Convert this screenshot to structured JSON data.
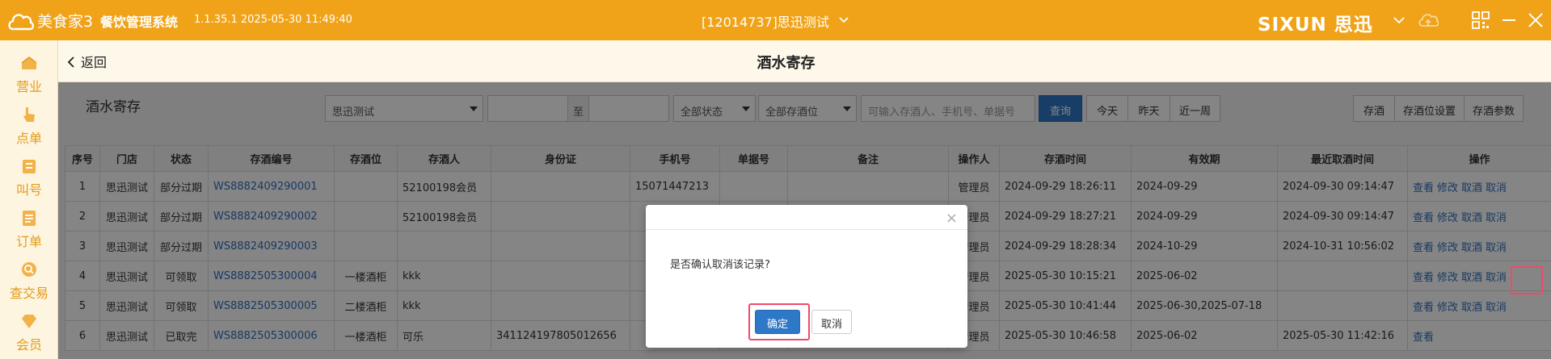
{
  "titlebar": {
    "brand": "美食家3",
    "system_name": "餐饮管理系统",
    "version": "1.1.35.1 2025-05-30 11:49:40",
    "store": "[12014737]思迅测试",
    "company_logo": "SIXUN 思迅",
    "accent_color": "#f0a318"
  },
  "sidebar": {
    "items": [
      {
        "label": "营业",
        "icon": "business-icon"
      },
      {
        "label": "点单",
        "icon": "order-hand-icon"
      },
      {
        "label": "叫号",
        "icon": "call-number-icon"
      },
      {
        "label": "订单",
        "icon": "orders-list-icon"
      },
      {
        "label": "查交易",
        "icon": "search-transaction-icon"
      },
      {
        "label": "会员",
        "icon": "member-diamond-icon"
      }
    ]
  },
  "header": {
    "back_label": "返回",
    "page_title": "酒水寄存"
  },
  "toolbar": {
    "section_title": "酒水寄存",
    "store_select": "思迅测试",
    "date_sep": "至",
    "status_select": "全部状态",
    "location_select": "全部存酒位",
    "search_placeholder": "可输入存酒人、手机号、单据号",
    "query_label": "查询",
    "today_label": "今天",
    "yesterday_label": "昨天",
    "last_week_label": "近一周",
    "deposit_label": "存酒",
    "location_settings_label": "存酒位设置",
    "params_label": "存酒参数"
  },
  "table": {
    "columns": [
      "序号",
      "门店",
      "状态",
      "存酒编号",
      "存酒位",
      "存酒人",
      "身份证",
      "手机号",
      "单据号",
      "备注",
      "操作人",
      "存酒时间",
      "有效期",
      "最近取酒时间",
      "操作"
    ],
    "rows": [
      {
        "no": "1",
        "store": "思迅测试",
        "status": "部分过期",
        "code": "WS8882409290001",
        "location": "",
        "depositor": "52100198会员",
        "id_card": "",
        "phone": "15071447213",
        "bill": "",
        "remark": "",
        "operator": "管理员",
        "deposit_time": "2024-09-29 18:26:11",
        "expiry": "2024-09-29",
        "last_pick": "2024-09-30 09:14:47",
        "ops": [
          "查看",
          "修改",
          "取酒",
          "取消"
        ]
      },
      {
        "no": "2",
        "store": "思迅测试",
        "status": "部分过期",
        "code": "WS8882409290002",
        "location": "",
        "depositor": "52100198会员",
        "id_card": "",
        "phone": "",
        "bill": "",
        "remark": "",
        "operator": "管理员",
        "deposit_time": "2024-09-29 18:27:21",
        "expiry": "2024-09-29",
        "last_pick": "2024-09-30 09:14:47",
        "ops": [
          "查看",
          "修改",
          "取酒",
          "取消"
        ]
      },
      {
        "no": "3",
        "store": "思迅测试",
        "status": "部分过期",
        "code": "WS8882409290003",
        "location": "",
        "depositor": "",
        "id_card": "",
        "phone": "",
        "bill": "",
        "remark": "",
        "operator": "管理员",
        "deposit_time": "2024-09-29 18:28:34",
        "expiry": "2024-10-29",
        "last_pick": "2024-10-31 10:56:02",
        "ops": [
          "查看",
          "修改",
          "取酒",
          "取消"
        ]
      },
      {
        "no": "4",
        "store": "思迅测试",
        "status": "可领取",
        "code": "WS8882505300004",
        "location": "一楼酒柜",
        "depositor": "kkk",
        "id_card": "",
        "phone": "",
        "bill": "",
        "remark": "",
        "operator": "管理员",
        "deposit_time": "2025-05-30 10:15:21",
        "expiry": "2025-06-02",
        "last_pick": "",
        "ops": [
          "查看",
          "修改",
          "取酒",
          "取消"
        ]
      },
      {
        "no": "5",
        "store": "思迅测试",
        "status": "可领取",
        "code": "WS8882505300005",
        "location": "二楼酒柜",
        "depositor": "kkk",
        "id_card": "",
        "phone": "",
        "bill": "",
        "remark": "",
        "operator": "管理员",
        "deposit_time": "2025-05-30 10:41:44",
        "expiry": "2025-06-30,2025-07-18",
        "last_pick": "",
        "ops": [
          "查看",
          "修改",
          "取酒",
          "取消"
        ]
      },
      {
        "no": "6",
        "store": "思迅测试",
        "status": "已取完",
        "code": "WS8882505300006",
        "location": "一楼酒柜",
        "depositor": "可乐",
        "id_card": "341124197805012656",
        "phone": "",
        "bill": "",
        "remark": "",
        "operator": "管理员",
        "deposit_time": "2025-05-30 10:46:58",
        "expiry": "2025-06-02",
        "last_pick": "2025-05-30 11:42:16",
        "ops": [
          "查看"
        ]
      }
    ]
  },
  "modal": {
    "message": "是否确认取消该记录?",
    "confirm_label": "确定",
    "cancel_label": "取消",
    "close_glyph": "×"
  }
}
